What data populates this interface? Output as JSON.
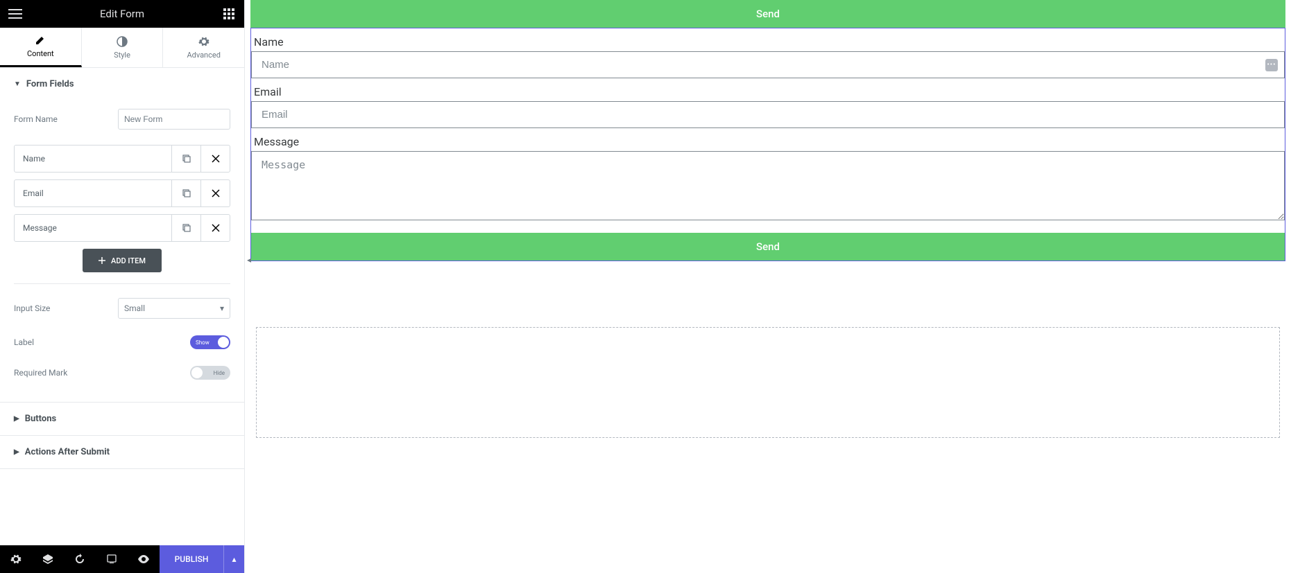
{
  "header": {
    "title": "Edit Form"
  },
  "tabs": {
    "content": "Content",
    "style": "Style",
    "advanced": "Advanced"
  },
  "sections": {
    "formFields": {
      "title": "Form Fields",
      "formNameLabel": "Form Name",
      "formNameValue": "New Form",
      "fields": [
        "Name",
        "Email",
        "Message"
      ],
      "addItem": "ADD ITEM",
      "inputSizeLabel": "Input Size",
      "inputSizeValue": "Small",
      "labelLabel": "Label",
      "labelToggleText": "Show",
      "requiredMarkLabel": "Required Mark",
      "requiredMarkToggleText": "Hide"
    },
    "buttons": {
      "title": "Buttons"
    },
    "afterSubmit": {
      "title": "Actions After Submit"
    }
  },
  "bottomBar": {
    "publish": "PUBLISH"
  },
  "preview": {
    "sendTop": "Send",
    "name": {
      "label": "Name",
      "placeholder": "Name"
    },
    "email": {
      "label": "Email",
      "placeholder": "Email"
    },
    "message": {
      "label": "Message",
      "placeholder": "Message"
    },
    "sendBottom": "Send"
  }
}
